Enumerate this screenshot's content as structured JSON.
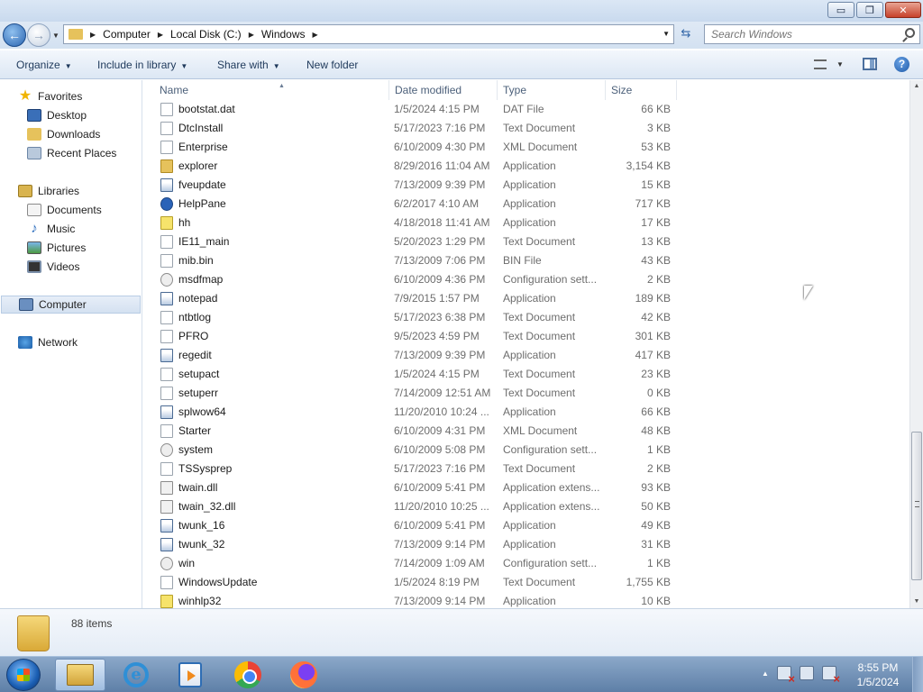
{
  "window": {
    "buttons": {
      "minimize": "▭",
      "maximize": "❐",
      "close": "✕"
    }
  },
  "address": {
    "breadcrumbs": [
      "Computer",
      "Local Disk (C:)",
      "Windows"
    ],
    "search_placeholder": "Search Windows"
  },
  "toolbar": {
    "organize": "Organize",
    "include_in_library": "Include in library",
    "share_with": "Share with",
    "new_folder": "New folder",
    "help": "?"
  },
  "nav": {
    "favorites": "Favorites",
    "desktop": "Desktop",
    "downloads": "Downloads",
    "recent_places": "Recent Places",
    "libraries": "Libraries",
    "documents": "Documents",
    "music": "Music",
    "pictures": "Pictures",
    "videos": "Videos",
    "computer": "Computer",
    "network": "Network"
  },
  "columns": {
    "name": "Name",
    "date_modified": "Date modified",
    "type": "Type",
    "size": "Size"
  },
  "files": [
    {
      "name": "bootstat.dat",
      "date": "1/5/2024 4:15 PM",
      "type": "DAT File",
      "size": "66 KB",
      "icon": "file"
    },
    {
      "name": "DtcInstall",
      "date": "5/17/2023 7:16 PM",
      "type": "Text Document",
      "size": "3 KB",
      "icon": "file"
    },
    {
      "name": "Enterprise",
      "date": "6/10/2009 4:30 PM",
      "type": "XML Document",
      "size": "53 KB",
      "icon": "file"
    },
    {
      "name": "explorer",
      "date": "8/29/2016 11:04 AM",
      "type": "Application",
      "size": "3,154 KB",
      "icon": "folder"
    },
    {
      "name": "fveupdate",
      "date": "7/13/2009 9:39 PM",
      "type": "Application",
      "size": "15 KB",
      "icon": "app"
    },
    {
      "name": "HelpPane",
      "date": "6/2/2017 4:10 AM",
      "type": "Application",
      "size": "717 KB",
      "icon": "help"
    },
    {
      "name": "hh",
      "date": "4/18/2018 11:41 AM",
      "type": "Application",
      "size": "17 KB",
      "icon": "hhq"
    },
    {
      "name": "IE11_main",
      "date": "5/20/2023 1:29 PM",
      "type": "Text Document",
      "size": "13 KB",
      "icon": "file"
    },
    {
      "name": "mib.bin",
      "date": "7/13/2009 7:06 PM",
      "type": "BIN File",
      "size": "43 KB",
      "icon": "file"
    },
    {
      "name": "msdfmap",
      "date": "6/10/2009 4:36 PM",
      "type": "Configuration sett...",
      "size": "2 KB",
      "icon": "cfg"
    },
    {
      "name": "notepad",
      "date": "7/9/2015 1:57 PM",
      "type": "Application",
      "size": "189 KB",
      "icon": "app"
    },
    {
      "name": "ntbtlog",
      "date": "5/17/2023 6:38 PM",
      "type": "Text Document",
      "size": "42 KB",
      "icon": "file"
    },
    {
      "name": "PFRO",
      "date": "9/5/2023 4:59 PM",
      "type": "Text Document",
      "size": "301 KB",
      "icon": "file"
    },
    {
      "name": "regedit",
      "date": "7/13/2009 9:39 PM",
      "type": "Application",
      "size": "417 KB",
      "icon": "app"
    },
    {
      "name": "setupact",
      "date": "1/5/2024 4:15 PM",
      "type": "Text Document",
      "size": "23 KB",
      "icon": "file"
    },
    {
      "name": "setuperr",
      "date": "7/14/2009 12:51 AM",
      "type": "Text Document",
      "size": "0 KB",
      "icon": "file"
    },
    {
      "name": "splwow64",
      "date": "11/20/2010 10:24 ...",
      "type": "Application",
      "size": "66 KB",
      "icon": "app"
    },
    {
      "name": "Starter",
      "date": "6/10/2009 4:31 PM",
      "type": "XML Document",
      "size": "48 KB",
      "icon": "file"
    },
    {
      "name": "system",
      "date": "6/10/2009 5:08 PM",
      "type": "Configuration sett...",
      "size": "1 KB",
      "icon": "cfg"
    },
    {
      "name": "TSSysprep",
      "date": "5/17/2023 7:16 PM",
      "type": "Text Document",
      "size": "2 KB",
      "icon": "file"
    },
    {
      "name": "twain.dll",
      "date": "6/10/2009 5:41 PM",
      "type": "Application extens...",
      "size": "93 KB",
      "icon": "dll"
    },
    {
      "name": "twain_32.dll",
      "date": "11/20/2010 10:25 ...",
      "type": "Application extens...",
      "size": "50 KB",
      "icon": "dll"
    },
    {
      "name": "twunk_16",
      "date": "6/10/2009 5:41 PM",
      "type": "Application",
      "size": "49 KB",
      "icon": "app"
    },
    {
      "name": "twunk_32",
      "date": "7/13/2009 9:14 PM",
      "type": "Application",
      "size": "31 KB",
      "icon": "app"
    },
    {
      "name": "win",
      "date": "7/14/2009 1:09 AM",
      "type": "Configuration sett...",
      "size": "1 KB",
      "icon": "cfg"
    },
    {
      "name": "WindowsUpdate",
      "date": "1/5/2024 8:19 PM",
      "type": "Text Document",
      "size": "1,755 KB",
      "icon": "file"
    },
    {
      "name": "winhlp32",
      "date": "7/13/2009 9:14 PM",
      "type": "Application",
      "size": "10 KB",
      "icon": "hhq"
    }
  ],
  "details": {
    "item_count": "88 items"
  },
  "taskbar": {
    "time": "8:55 PM",
    "date": "1/5/2024"
  },
  "colors": {
    "accent": "#3367a8",
    "taskbar": "#5e7fa7"
  }
}
